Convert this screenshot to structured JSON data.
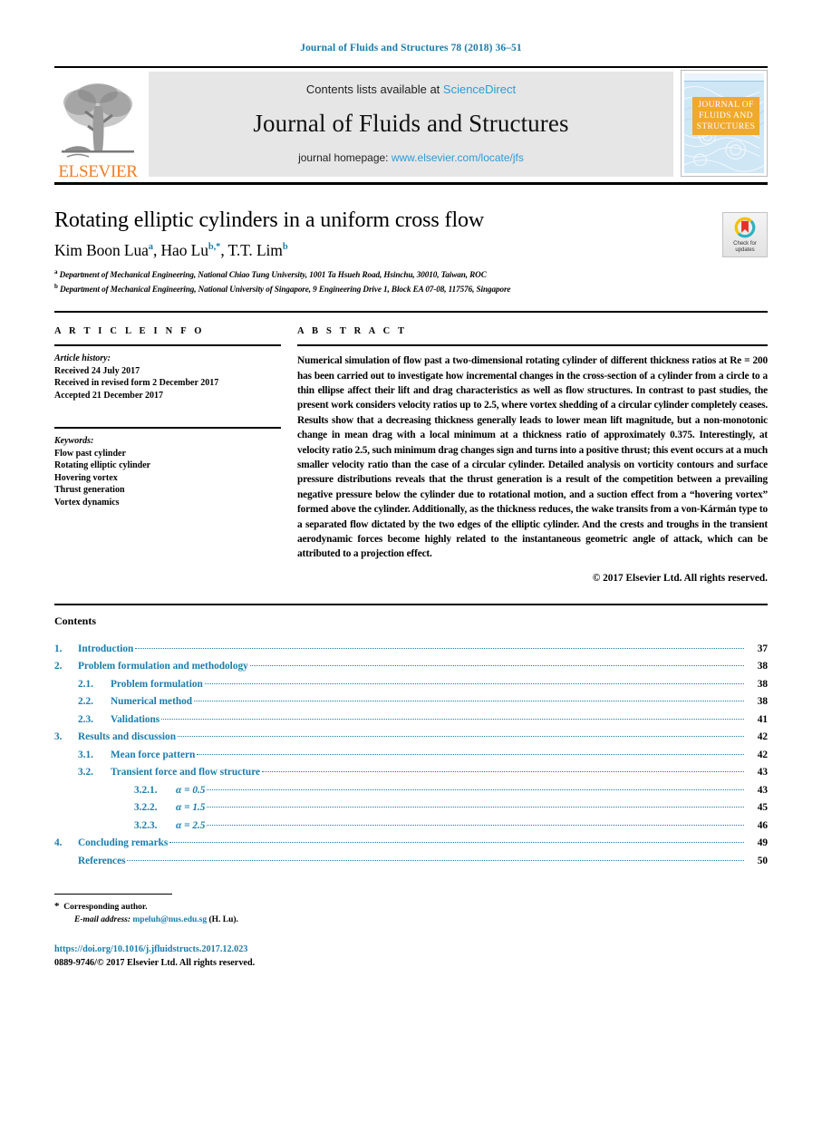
{
  "running_head": "Journal of Fluids and Structures 78 (2018) 36–51",
  "masthead": {
    "publisher_name": "ELSEVIER",
    "publisher_logo_icon": "elsevier-tree-icon",
    "contents_line_prefix": "Contents lists available at ",
    "contents_line_link": "ScienceDirect",
    "journal_title": "Journal of Fluids and Structures",
    "homepage_prefix": "journal homepage: ",
    "homepage_link": "www.elsevier.com/locate/jfs",
    "cover_label": "JOURNAL OF FLUIDS AND STRUCTURES",
    "cover_topbar_text": "· · ·"
  },
  "title": "Rotating elliptic cylinders in a uniform cross flow",
  "authors": [
    {
      "name": "Kim Boon Lua",
      "marks": "a",
      "sep": ", "
    },
    {
      "name": "Hao Lu",
      "marks": "b,*",
      "sep": ", "
    },
    {
      "name": "T.T. Lim",
      "marks": "b",
      "sep": ""
    }
  ],
  "affiliations": [
    {
      "mark": "a",
      "text": "Department of Mechanical Engineering, National Chiao Tung University, 1001 Ta Hsueh Road, Hsinchu, 30010, Taiwan, ROC"
    },
    {
      "mark": "b",
      "text": "Department of Mechanical Engineering, National University of Singapore, 9 Engineering Drive 1, Block EA 07-08, 117576, Singapore"
    }
  ],
  "crossmark": {
    "line1": "Check for",
    "line2": "updates",
    "icon": "crossmark-check-for-updates-icon"
  },
  "article_info": {
    "heading": "A R T I C L E   I N F O",
    "history_label": "Article history:",
    "history": [
      "Received 24 July 2017",
      "Received in revised form 2 December 2017",
      "Accepted 21 December 2017"
    ],
    "keywords_label": "Keywords:",
    "keywords": [
      "Flow past cylinder",
      "Rotating elliptic cylinder",
      "Hovering vortex",
      "Thrust generation",
      "Vortex dynamics"
    ]
  },
  "abstract": {
    "heading": "A B S T R A C T",
    "text": "Numerical simulation of flow past a two-dimensional rotating cylinder of different thickness ratios at Re = 200 has been carried out to investigate how incremental changes in the cross-section of a cylinder from a circle to a thin ellipse affect their lift and drag characteristics as well as flow structures. In contrast to past studies, the present work considers velocity ratios up to 2.5, where vortex shedding of a circular cylinder completely ceases. Results show that a decreasing thickness generally leads to lower mean lift magnitude, but a non-monotonic change in mean drag with a local minimum at a thickness ratio of approximately 0.375. Interestingly, at velocity ratio 2.5, such minimum drag changes sign and turns into a positive thrust; this event occurs at a much smaller velocity ratio than the case of a circular cylinder. Detailed analysis on vorticity contours and surface pressure distributions reveals that the thrust generation is a result of the competition between a prevailing negative pressure below the cylinder due to rotational motion, and a suction effect from a “hovering vortex” formed above the cylinder. Additionally, as the thickness reduces, the wake transits from a von-Kármán type to a separated flow dictated by the two edges of the elliptic cylinder. And the crests and troughs in the transient aerodynamic forces become highly related to the instantaneous geometric angle of attack, which can be attributed to a projection effect.",
    "copyright": "© 2017 Elsevier Ltd. All rights reserved."
  },
  "contents": {
    "heading": "Contents",
    "entries": [
      {
        "level": 1,
        "num": "1.",
        "label": "Introduction",
        "page": "37"
      },
      {
        "level": 1,
        "num": "2.",
        "label": "Problem formulation and methodology",
        "page": "38"
      },
      {
        "level": 2,
        "num": "2.1.",
        "label": "Problem formulation",
        "page": "38"
      },
      {
        "level": 2,
        "num": "2.2.",
        "label": "Numerical method",
        "page": "38"
      },
      {
        "level": 2,
        "num": "2.3.",
        "label": "Validations",
        "page": "41"
      },
      {
        "level": 1,
        "num": "3.",
        "label": "Results and discussion",
        "page": "42"
      },
      {
        "level": 2,
        "num": "3.1.",
        "label": "Mean force pattern",
        "page": "42"
      },
      {
        "level": 2,
        "num": "3.2.",
        "label": "Transient force and flow structure",
        "page": "43"
      },
      {
        "level": 3,
        "num": "3.2.1.",
        "label": "α = 0.5",
        "page": "43"
      },
      {
        "level": 3,
        "num": "3.2.2.",
        "label": "α = 1.5",
        "page": "45"
      },
      {
        "level": 3,
        "num": "3.2.3.",
        "label": "α = 2.5",
        "page": "46"
      },
      {
        "level": 1,
        "num": "4.",
        "label": "Concluding remarks",
        "page": "49"
      },
      {
        "level": 0,
        "num": "",
        "label": "References",
        "page": "50"
      }
    ]
  },
  "footnote": {
    "star": "*",
    "corresponding": "Corresponding author.",
    "email_label": "E-mail address:",
    "email": "mpeluh@nus.edu.sg",
    "email_suffix": "(H. Lu)."
  },
  "footer": {
    "doi": "https://doi.org/10.1016/j.jfluidstructs.2017.12.023",
    "issn_line": "0889-9746/© 2017 Elsevier Ltd. All rights reserved."
  },
  "colors": {
    "link_blue": "#1a7cab",
    "sd_blue": "#2e9bd6",
    "elsevier_orange": "#f07c24",
    "cover_blue": "#cfe6f5",
    "cover_label_orange": "#f0a92b"
  }
}
